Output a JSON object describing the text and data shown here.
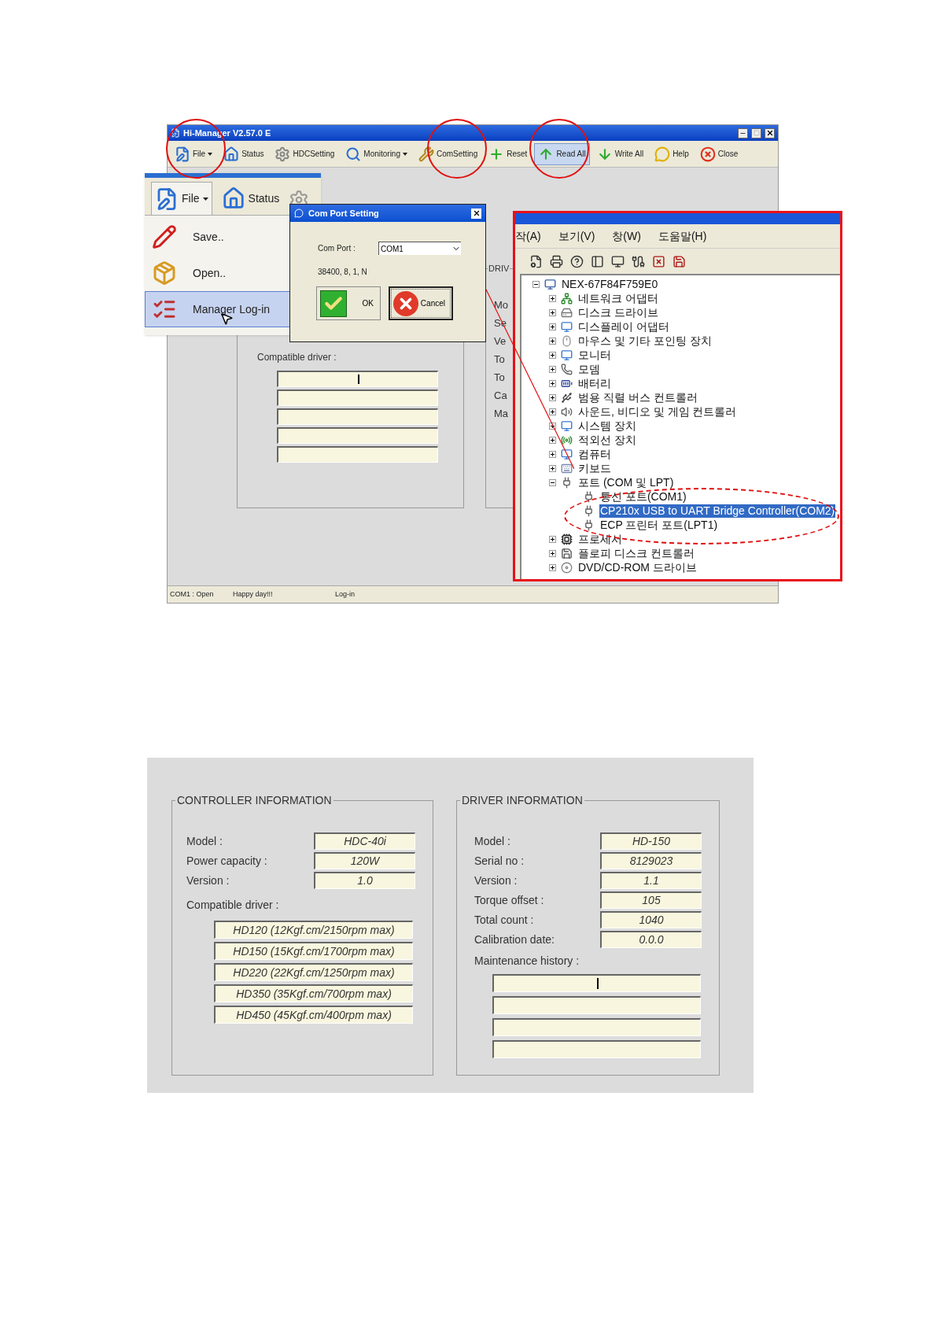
{
  "main_window": {
    "title": "Hi-Manager V2.57.0 E",
    "toolbar": [
      {
        "label": "File",
        "dropdown": true,
        "selected": false
      },
      {
        "label": "Status",
        "dropdown": false,
        "selected": false
      },
      {
        "label": "HDCSetting",
        "dropdown": false,
        "selected": false
      },
      {
        "label": "Monitoring",
        "dropdown": true,
        "selected": false
      },
      {
        "label": "ComSetting",
        "dropdown": false,
        "selected": false
      },
      {
        "label": "Reset",
        "dropdown": false,
        "selected": false
      },
      {
        "label": "Read All",
        "dropdown": false,
        "selected": true
      },
      {
        "label": "Write All",
        "dropdown": false,
        "selected": false
      },
      {
        "label": "Help",
        "dropdown": false,
        "selected": false
      },
      {
        "label": "Close",
        "dropdown": false,
        "selected": false
      }
    ],
    "controller_panel": {
      "label": "Compatible driver :",
      "fields": [
        {
          "cursor": true
        },
        {
          "cursor": false
        },
        {
          "cursor": false
        },
        {
          "cursor": false
        },
        {
          "cursor": false
        }
      ]
    },
    "driver_panel": {
      "title": "DRIV",
      "labels": [
        "Mo",
        "Se",
        "Ve",
        "To",
        "To",
        "Ca",
        "Ma"
      ]
    },
    "status_bar": [
      "COM1 : Open",
      "Happy day!!!",
      "Log-in"
    ]
  },
  "file_menu": {
    "toolbar": [
      {
        "label": "File",
        "dropdown": true
      },
      {
        "label": "Status",
        "dropdown": false
      }
    ],
    "items": [
      {
        "label": "Save..",
        "selected": false
      },
      {
        "label": "Open..",
        "selected": false
      },
      {
        "label": "Manager Log-in",
        "selected": true
      }
    ]
  },
  "com_port_dialog": {
    "title": "Com Port Setting",
    "port_label": "Com Port :",
    "port_value": "COM1",
    "settings": "38400, 8, 1, N",
    "buttons": [
      {
        "label": "OK",
        "focused": false
      },
      {
        "label": "Cancel",
        "focused": true
      }
    ]
  },
  "device_manager": {
    "menu": [
      "작(A)",
      "보기(V)",
      "창(W)",
      "도움말(H)"
    ],
    "tree": {
      "label": "NEX-67F84F759E0",
      "expanded": true,
      "selected": false,
      "children": [
        {
          "label": "네트워크 어댑터",
          "expanded": false,
          "selected": false
        },
        {
          "label": "디스크 드라이브",
          "expanded": false,
          "selected": false
        },
        {
          "label": "디스플레이 어댑터",
          "expanded": false,
          "selected": false
        },
        {
          "label": "마우스 및 기타 포인팅 장치",
          "expanded": false,
          "selected": false
        },
        {
          "label": "모니터",
          "expanded": false,
          "selected": false
        },
        {
          "label": "모뎀",
          "expanded": false,
          "selected": false
        },
        {
          "label": "배터리",
          "expanded": false,
          "selected": false
        },
        {
          "label": "범용 직렬 버스 컨트롤러",
          "expanded": false,
          "selected": false
        },
        {
          "label": "사운드, 비디오 및 게임 컨트롤러",
          "expanded": false,
          "selected": false
        },
        {
          "label": "시스템 장치",
          "expanded": false,
          "selected": false
        },
        {
          "label": "적외선 장치",
          "expanded": false,
          "selected": false
        },
        {
          "label": "컴퓨터",
          "expanded": false,
          "selected": false
        },
        {
          "label": "키보드",
          "expanded": false,
          "selected": false
        },
        {
          "label": "포트 (COM 및 LPT)",
          "expanded": true,
          "selected": false,
          "children": [
            {
              "label": "통신 포트(COM1)",
              "selected": false
            },
            {
              "label": "CP210x USB to UART Bridge Controller(COM2)",
              "selected": true
            },
            {
              "label": "ECP 프린터 포트(LPT1)",
              "selected": false
            }
          ]
        },
        {
          "label": "프로세서",
          "expanded": false,
          "selected": false
        },
        {
          "label": "플로피 디스크 컨트롤러",
          "expanded": false,
          "selected": false
        },
        {
          "label": "DVD/CD-ROM 드라이브",
          "expanded": false,
          "selected": false
        }
      ]
    }
  },
  "info_screen": {
    "controller": {
      "title": "CONTROLLER  INFORMATION",
      "rows": [
        {
          "label": "Model :",
          "value": "HDC-40i"
        },
        {
          "label": "Power capacity :",
          "value": "120W"
        },
        {
          "label": "Version :",
          "value": "1.0"
        }
      ],
      "compatible_label": "Compatible driver :",
      "drivers": [
        "HD120 (12Kgf.cm/2150rpm max)",
        "HD150 (15Kgf.cm/1700rpm max)",
        "HD220 (22Kgf.cm/1250rpm max)",
        "HD350 (35Kgf.cm/700rpm max)",
        "HD450 (45Kgf.cm/400rpm max)"
      ]
    },
    "driver": {
      "title": "DRIVER INFORMATION",
      "rows": [
        {
          "label": "Model :",
          "value": "HD-150"
        },
        {
          "label": "Serial no :",
          "value": "8129023"
        },
        {
          "label": "Version :",
          "value": "1.1"
        },
        {
          "label": "Torque offset :",
          "value": "105"
        },
        {
          "label": "Total count :",
          "value": "1040"
        },
        {
          "label": "Calibration date:",
          "value": "0.0.0"
        }
      ],
      "history_label": "Maintenance history :",
      "history": [
        {
          "cursor": true
        },
        {
          "cursor": false
        },
        {
          "cursor": false
        },
        {
          "cursor": false
        }
      ]
    }
  }
}
